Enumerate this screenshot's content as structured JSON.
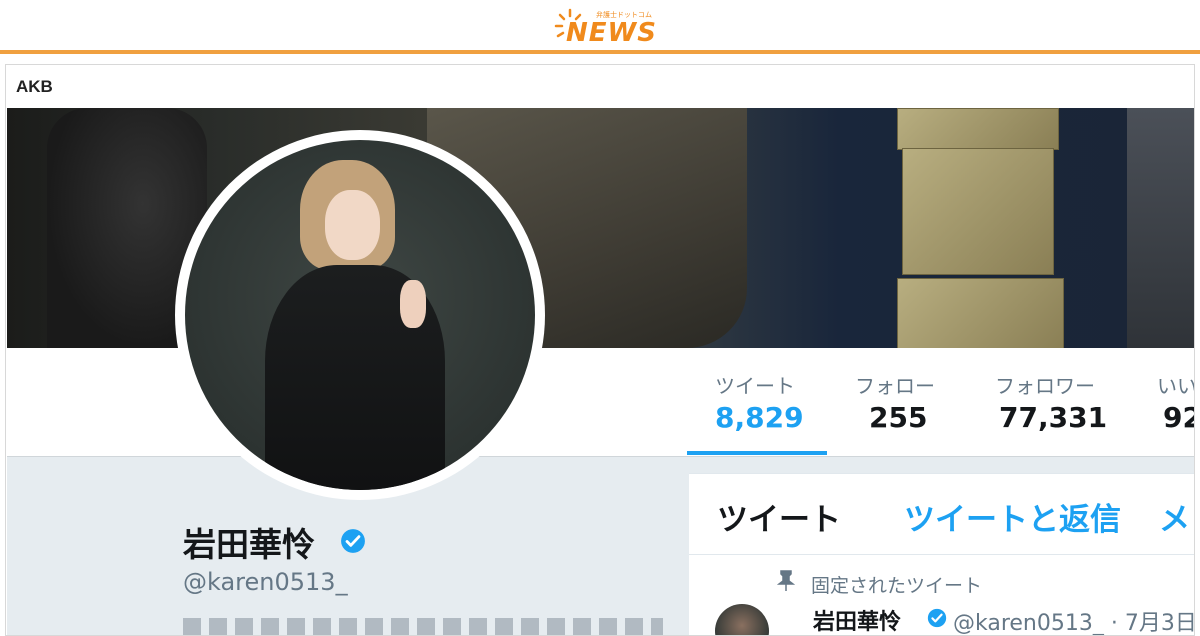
{
  "site": {
    "logo_word": "NEWS",
    "logo_tag": "弁護士ドットコム",
    "accent": "#f08a1c"
  },
  "card": {
    "label": "AKB"
  },
  "profile": {
    "display_name": "岩田華怜",
    "handle": "@karen0513_",
    "verified": true,
    "stats": [
      {
        "label": "ツイート",
        "value": "8,829",
        "active": true
      },
      {
        "label": "フォロー",
        "value": "255"
      },
      {
        "label": "フォロワー",
        "value": "77,331"
      },
      {
        "label": "いい",
        "value": "92"
      }
    ]
  },
  "timeline": {
    "tabs": [
      "ツイート",
      "ツイートと返信",
      "メ"
    ],
    "pinned_label": "固定されたツイート",
    "tweet": {
      "name": "岩田華怜",
      "handle": "@karen0513_",
      "date": "· 7月3日"
    }
  },
  "colors": {
    "twitter_blue": "#1da1f2",
    "text_dark": "#14171a",
    "text_gray": "#657786"
  }
}
